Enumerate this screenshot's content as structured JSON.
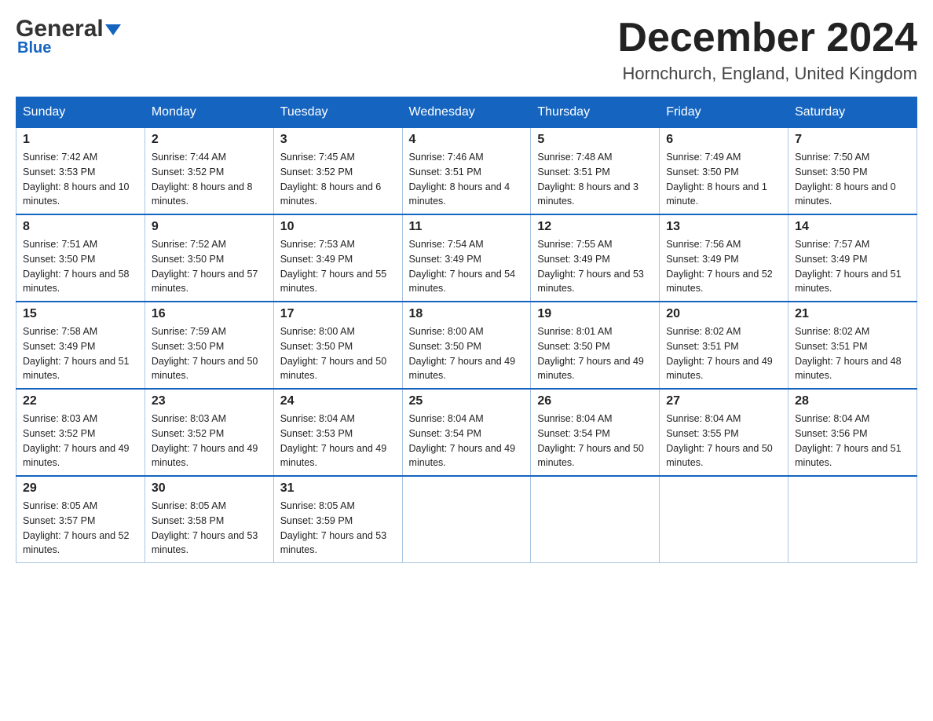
{
  "header": {
    "logo_general": "General",
    "logo_blue": "Blue",
    "month_title": "December 2024",
    "location": "Hornchurch, England, United Kingdom"
  },
  "days_of_week": [
    "Sunday",
    "Monday",
    "Tuesday",
    "Wednesday",
    "Thursday",
    "Friday",
    "Saturday"
  ],
  "weeks": [
    [
      {
        "day": "1",
        "sunrise": "7:42 AM",
        "sunset": "3:53 PM",
        "daylight": "8 hours and 10 minutes."
      },
      {
        "day": "2",
        "sunrise": "7:44 AM",
        "sunset": "3:52 PM",
        "daylight": "8 hours and 8 minutes."
      },
      {
        "day": "3",
        "sunrise": "7:45 AM",
        "sunset": "3:52 PM",
        "daylight": "8 hours and 6 minutes."
      },
      {
        "day": "4",
        "sunrise": "7:46 AM",
        "sunset": "3:51 PM",
        "daylight": "8 hours and 4 minutes."
      },
      {
        "day": "5",
        "sunrise": "7:48 AM",
        "sunset": "3:51 PM",
        "daylight": "8 hours and 3 minutes."
      },
      {
        "day": "6",
        "sunrise": "7:49 AM",
        "sunset": "3:50 PM",
        "daylight": "8 hours and 1 minute."
      },
      {
        "day": "7",
        "sunrise": "7:50 AM",
        "sunset": "3:50 PM",
        "daylight": "8 hours and 0 minutes."
      }
    ],
    [
      {
        "day": "8",
        "sunrise": "7:51 AM",
        "sunset": "3:50 PM",
        "daylight": "7 hours and 58 minutes."
      },
      {
        "day": "9",
        "sunrise": "7:52 AM",
        "sunset": "3:50 PM",
        "daylight": "7 hours and 57 minutes."
      },
      {
        "day": "10",
        "sunrise": "7:53 AM",
        "sunset": "3:49 PM",
        "daylight": "7 hours and 55 minutes."
      },
      {
        "day": "11",
        "sunrise": "7:54 AM",
        "sunset": "3:49 PM",
        "daylight": "7 hours and 54 minutes."
      },
      {
        "day": "12",
        "sunrise": "7:55 AM",
        "sunset": "3:49 PM",
        "daylight": "7 hours and 53 minutes."
      },
      {
        "day": "13",
        "sunrise": "7:56 AM",
        "sunset": "3:49 PM",
        "daylight": "7 hours and 52 minutes."
      },
      {
        "day": "14",
        "sunrise": "7:57 AM",
        "sunset": "3:49 PM",
        "daylight": "7 hours and 51 minutes."
      }
    ],
    [
      {
        "day": "15",
        "sunrise": "7:58 AM",
        "sunset": "3:49 PM",
        "daylight": "7 hours and 51 minutes."
      },
      {
        "day": "16",
        "sunrise": "7:59 AM",
        "sunset": "3:50 PM",
        "daylight": "7 hours and 50 minutes."
      },
      {
        "day": "17",
        "sunrise": "8:00 AM",
        "sunset": "3:50 PM",
        "daylight": "7 hours and 50 minutes."
      },
      {
        "day": "18",
        "sunrise": "8:00 AM",
        "sunset": "3:50 PM",
        "daylight": "7 hours and 49 minutes."
      },
      {
        "day": "19",
        "sunrise": "8:01 AM",
        "sunset": "3:50 PM",
        "daylight": "7 hours and 49 minutes."
      },
      {
        "day": "20",
        "sunrise": "8:02 AM",
        "sunset": "3:51 PM",
        "daylight": "7 hours and 49 minutes."
      },
      {
        "day": "21",
        "sunrise": "8:02 AM",
        "sunset": "3:51 PM",
        "daylight": "7 hours and 48 minutes."
      }
    ],
    [
      {
        "day": "22",
        "sunrise": "8:03 AM",
        "sunset": "3:52 PM",
        "daylight": "7 hours and 49 minutes."
      },
      {
        "day": "23",
        "sunrise": "8:03 AM",
        "sunset": "3:52 PM",
        "daylight": "7 hours and 49 minutes."
      },
      {
        "day": "24",
        "sunrise": "8:04 AM",
        "sunset": "3:53 PM",
        "daylight": "7 hours and 49 minutes."
      },
      {
        "day": "25",
        "sunrise": "8:04 AM",
        "sunset": "3:54 PM",
        "daylight": "7 hours and 49 minutes."
      },
      {
        "day": "26",
        "sunrise": "8:04 AM",
        "sunset": "3:54 PM",
        "daylight": "7 hours and 50 minutes."
      },
      {
        "day": "27",
        "sunrise": "8:04 AM",
        "sunset": "3:55 PM",
        "daylight": "7 hours and 50 minutes."
      },
      {
        "day": "28",
        "sunrise": "8:04 AM",
        "sunset": "3:56 PM",
        "daylight": "7 hours and 51 minutes."
      }
    ],
    [
      {
        "day": "29",
        "sunrise": "8:05 AM",
        "sunset": "3:57 PM",
        "daylight": "7 hours and 52 minutes."
      },
      {
        "day": "30",
        "sunrise": "8:05 AM",
        "sunset": "3:58 PM",
        "daylight": "7 hours and 53 minutes."
      },
      {
        "day": "31",
        "sunrise": "8:05 AM",
        "sunset": "3:59 PM",
        "daylight": "7 hours and 53 minutes."
      },
      null,
      null,
      null,
      null
    ]
  ]
}
